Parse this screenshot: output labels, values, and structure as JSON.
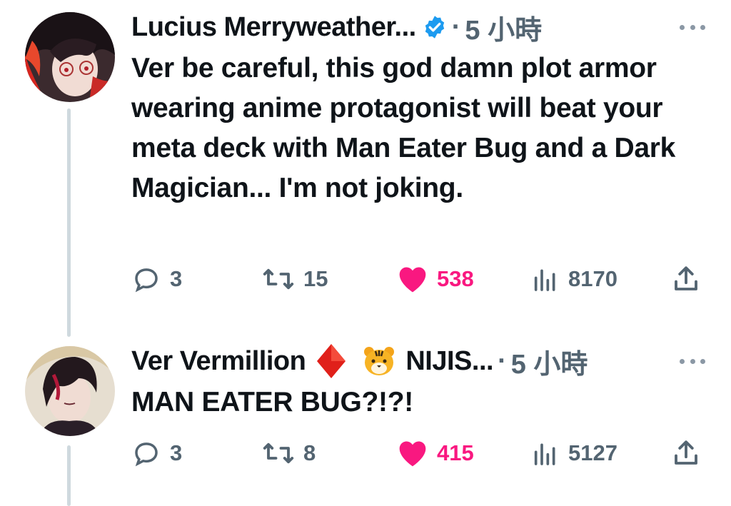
{
  "tweets": [
    {
      "author": "Lucius Merryweather...",
      "dot": "·",
      "time": "5 小時",
      "icons": {
        "verified": "verified-badge-icon",
        "more": "more-options-icon"
      },
      "text": "Ver be careful, this god damn plot armor wearing anime protagonist will beat your meta deck with Man Eater Bug and a Dark Magician... I'm not joking.",
      "stats": {
        "replies": "3",
        "retweets": "15",
        "likes": "538",
        "views": "8170"
      },
      "liked": true,
      "colors": {
        "like": "#f91880",
        "verified": "#1d9bf0"
      }
    },
    {
      "author": "Ver Vermillion",
      "author_suffix": "NIJIS...",
      "dot": "·",
      "time": "5 小時",
      "icons": {
        "diamond": "red-diamond-emoji",
        "tiger": "tiger-face-emoji",
        "more": "more-options-icon"
      },
      "text": "MAN EATER BUG?!?!",
      "stats": {
        "replies": "3",
        "retweets": "8",
        "likes": "415",
        "views": "5127"
      },
      "liked": true
    }
  ]
}
